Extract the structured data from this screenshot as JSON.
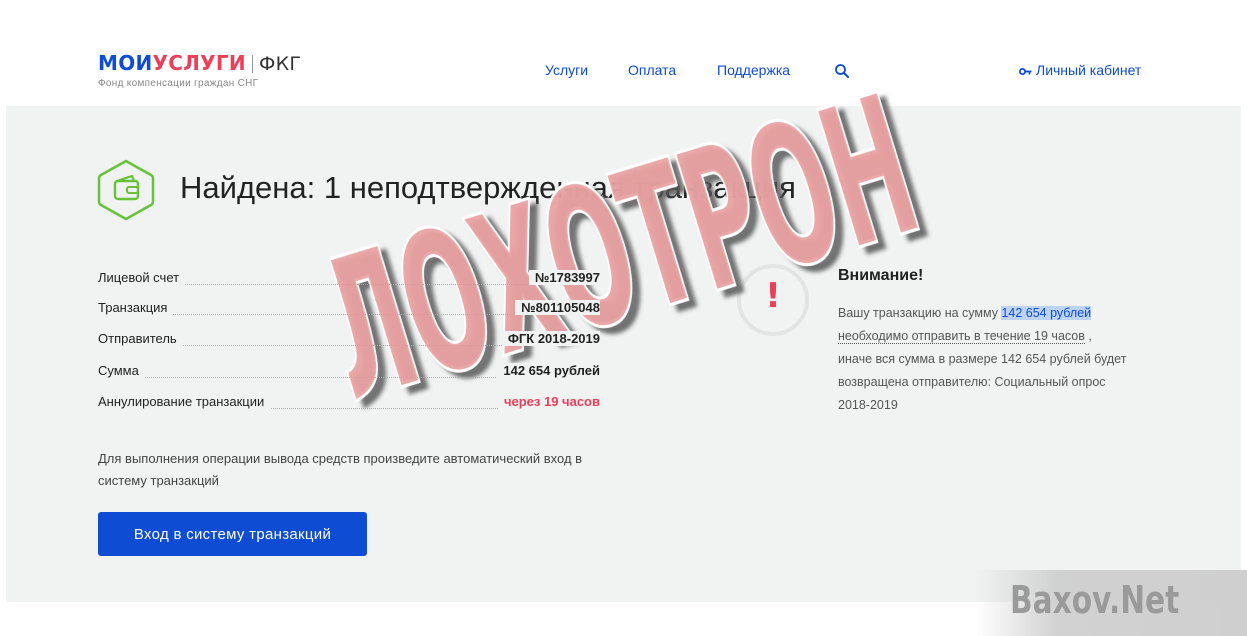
{
  "header": {
    "logo": {
      "moi": "МОИ",
      "uslugi": "УСЛУГИ",
      "fkg": "ФКГ",
      "subtitle": "Фонд компенсации граждан СНГ"
    },
    "nav": [
      "Услуги",
      "Оплата",
      "Поддержка"
    ],
    "cabinet_label": "Личный кабинет"
  },
  "main": {
    "title": "Найдена: 1 неподтвержденная транзакция",
    "details": [
      {
        "label": "Лицевой счет",
        "value": "№1783997"
      },
      {
        "label": "Транзакция",
        "value": "№801105048"
      },
      {
        "label": "Отправитель",
        "value": "ФГК 2018-2019"
      },
      {
        "label": "Сумма",
        "value": "142 654 рублей"
      },
      {
        "label": "Аннулирование транзакции",
        "value": "через 19 часов"
      }
    ],
    "instruction": "Для выполнения операции вывода средств произведите автоматический вход в систему транзакций",
    "button_label": "Вход в систему транзакций"
  },
  "attention": {
    "icon_mark": "!",
    "title": "Внимание!",
    "text_1": "Вашу транзакцию на сумму ",
    "amount": "142 654 рублей",
    "deadline": "необходимо отправить в течение 19 часов",
    "text_2": " , иначе вся сумма в размере 142 654 рублей будет возвращена отправителю: Социальный опрос 2018-2019"
  },
  "stamp_text": "ЛОХОТРОН",
  "watermark": "Baxov.Net",
  "colors": {
    "brand_blue": "#0d4cd3",
    "brand_red": "#ee3f58",
    "stamp_fill": "#e8a0a0",
    "panel_bg": "#f1f3f3",
    "icon_green": "#67c23a"
  }
}
